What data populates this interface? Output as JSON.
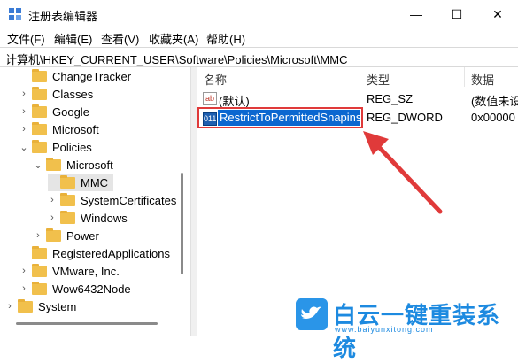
{
  "window": {
    "title": "注册表编辑器",
    "minimize": "—",
    "maximize": "☐",
    "close": "✕"
  },
  "menu": [
    "文件(F)",
    "编辑(E)",
    "查看(V)",
    "收藏夹(A)",
    "帮助(H)"
  ],
  "address": "计算机\\HKEY_CURRENT_USER\\Software\\Policies\\Microsoft\\MMC",
  "tree": [
    {
      "label": "ChangeTracker"
    },
    {
      "label": "Classes",
      "chevron": "›"
    },
    {
      "label": "Google",
      "chevron": "›"
    },
    {
      "label": "Microsoft",
      "chevron": "›"
    },
    {
      "label": "Policies",
      "chevron": "⌄"
    },
    {
      "label": "Microsoft",
      "chevron": "⌄"
    },
    {
      "label": "MMC",
      "selected": true
    },
    {
      "label": "SystemCertificates",
      "chevron": "›"
    },
    {
      "label": "Windows",
      "chevron": "›"
    },
    {
      "label": "Power",
      "chevron": "›"
    },
    {
      "label": "RegisteredApplications"
    },
    {
      "label": "VMware, Inc.",
      "chevron": "›"
    },
    {
      "label": "Wow6432Node",
      "chevron": "›"
    },
    {
      "label": "System",
      "chevron": "›"
    }
  ],
  "columns": {
    "name": "名称",
    "type": "类型",
    "data": "数据"
  },
  "values": [
    {
      "name": "(默认)",
      "type": "REG_SZ",
      "data": "(数值未设",
      "icon": "ab"
    },
    {
      "name": "RestrictToPermittedSnapins",
      "type": "REG_DWORD",
      "data": "0x00000",
      "icon": "011"
    }
  ],
  "watermark": {
    "name": "白云一键重装系统",
    "url": "www.baiyunxitong.com"
  },
  "colors": {
    "selection": "#0b67d0",
    "highlight_border": "#e03a3a",
    "folder": "#f1c04c"
  }
}
